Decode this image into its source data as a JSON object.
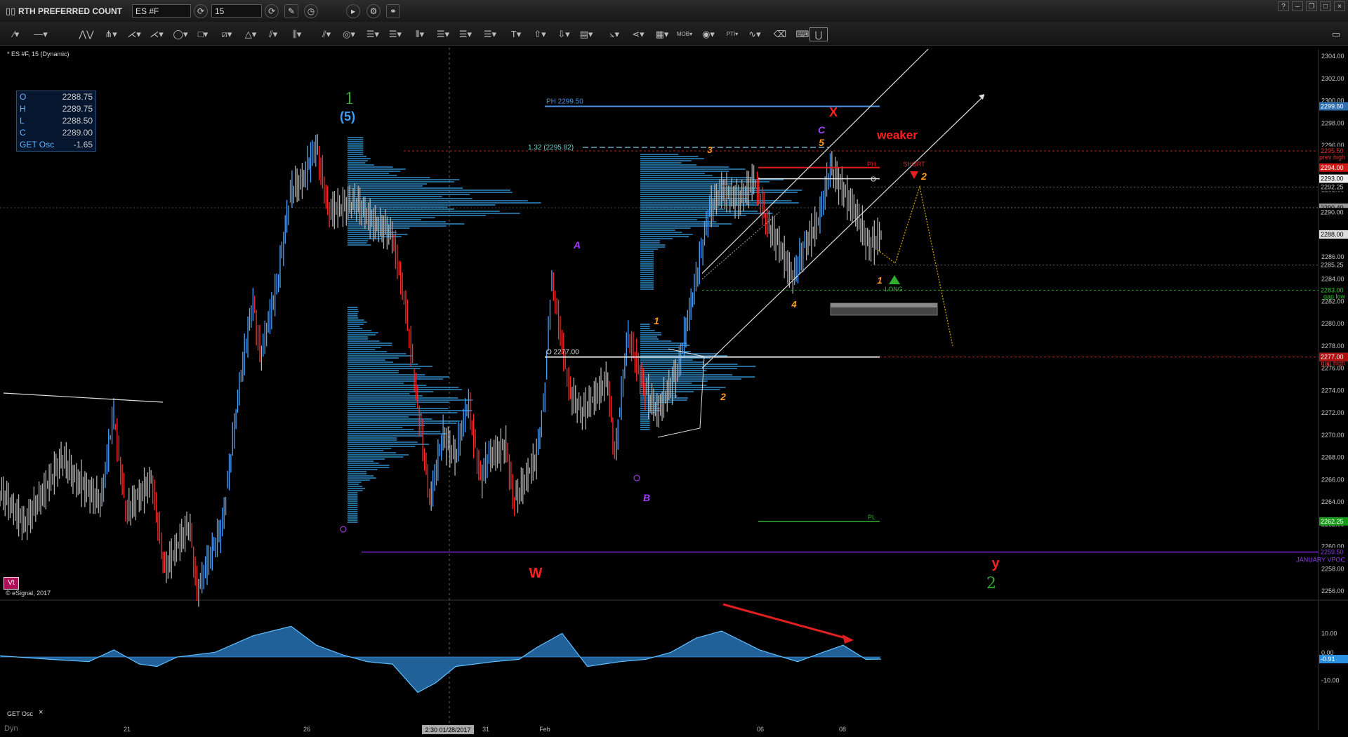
{
  "window": {
    "title": "RTH  PREFERRED COUNT",
    "symbol": "ES #F",
    "interval": "15",
    "chart_caption": "* ES #F, 15 (Dynamic)",
    "copyright": "© eSignal, 2017",
    "vt_badge": "Vt",
    "osc_caption": "GET Osc",
    "osc_close": "×",
    "dyn_label": "Dyn"
  },
  "ohlc": [
    {
      "k": "O",
      "v": "2288.75"
    },
    {
      "k": "H",
      "v": "2289.75"
    },
    {
      "k": "L",
      "v": "2288.50"
    },
    {
      "k": "C",
      "v": "2289.00"
    },
    {
      "k": "GET Osc",
      "v": "-1.65"
    }
  ],
  "colors": {
    "up_bar": "#4aa3ff",
    "down_bar": "#ff2a2a",
    "neutral_bar": "#b0b0b0",
    "profile": "#2f8dc8",
    "osc": "#3aa0ff",
    "price_axis_text": "#c8c8c8",
    "wave_orange": "#ff9a1f",
    "wave_purple": "#a040ff",
    "wave_red": "#ff2020",
    "wave_green": "#2fae2f",
    "wave_blue": "#3aa0ff",
    "vpoc": "#7a2ad6"
  },
  "chart_data": {
    "type": "candlestick",
    "x_ticks": [
      "21",
      "26",
      "31",
      "Feb",
      "06",
      "08"
    ],
    "crosshair_time": "2:30 01/28/2017",
    "y_ticks": [
      "2304.00",
      "2302.00",
      "2300.00",
      "2298.00",
      "2296.00",
      "2294.00",
      "2292.00",
      "2290.00",
      "2288.00",
      "2286.00",
      "2284.00",
      "2282.00",
      "2280.00",
      "2278.00",
      "2276.00",
      "2274.00",
      "2272.00",
      "2270.00",
      "2268.00",
      "2266.00",
      "2264.00",
      "2262.00",
      "2260.00",
      "2258.00",
      "2256.00"
    ],
    "y_range": [
      2255,
      2305
    ],
    "price_series": [
      {
        "x": 0,
        "y": 2265
      },
      {
        "x": 10,
        "y": 2262
      },
      {
        "x": 25,
        "y": 2268
      },
      {
        "x": 30,
        "y": 2266
      },
      {
        "x": 40,
        "y": 2264
      },
      {
        "x": 45,
        "y": 2272
      },
      {
        "x": 50,
        "y": 2263
      },
      {
        "x": 60,
        "y": 2266
      },
      {
        "x": 65,
        "y": 2258
      },
      {
        "x": 75,
        "y": 2262
      },
      {
        "x": 78,
        "y": 2256
      },
      {
        "x": 88,
        "y": 2262
      },
      {
        "x": 95,
        "y": 2275
      },
      {
        "x": 100,
        "y": 2282
      },
      {
        "x": 103,
        "y": 2277
      },
      {
        "x": 110,
        "y": 2284
      },
      {
        "x": 115,
        "y": 2292
      },
      {
        "x": 120,
        "y": 2293
      },
      {
        "x": 125,
        "y": 2296
      },
      {
        "x": 130,
        "y": 2290
      },
      {
        "x": 140,
        "y": 2291
      },
      {
        "x": 148,
        "y": 2289
      },
      {
        "x": 155,
        "y": 2288
      },
      {
        "x": 160,
        "y": 2282
      },
      {
        "x": 170,
        "y": 2264
      },
      {
        "x": 175,
        "y": 2270
      },
      {
        "x": 180,
        "y": 2268
      },
      {
        "x": 185,
        "y": 2273
      },
      {
        "x": 190,
        "y": 2266
      },
      {
        "x": 193,
        "y": 2268
      },
      {
        "x": 200,
        "y": 2269
      },
      {
        "x": 203,
        "y": 2264
      },
      {
        "x": 212,
        "y": 2268
      },
      {
        "x": 215,
        "y": 2273
      },
      {
        "x": 218,
        "y": 2284
      },
      {
        "x": 225,
        "y": 2274
      },
      {
        "x": 230,
        "y": 2272
      },
      {
        "x": 240,
        "y": 2275
      },
      {
        "x": 243,
        "y": 2268
      },
      {
        "x": 248,
        "y": 2279
      },
      {
        "x": 255,
        "y": 2274
      },
      {
        "x": 260,
        "y": 2272
      },
      {
        "x": 268,
        "y": 2276
      },
      {
        "x": 275,
        "y": 2284
      },
      {
        "x": 280,
        "y": 2290
      },
      {
        "x": 285,
        "y": 2292
      },
      {
        "x": 292,
        "y": 2291
      },
      {
        "x": 298,
        "y": 2293
      },
      {
        "x": 303,
        "y": 2289
      },
      {
        "x": 308,
        "y": 2287
      },
      {
        "x": 313,
        "y": 2284
      },
      {
        "x": 318,
        "y": 2287
      },
      {
        "x": 323,
        "y": 2289
      },
      {
        "x": 328,
        "y": 2294
      },
      {
        "x": 333,
        "y": 2292
      },
      {
        "x": 338,
        "y": 2290
      },
      {
        "x": 343,
        "y": 2287
      },
      {
        "x": 348,
        "y": 2288
      }
    ],
    "levels": [
      {
        "label": "PH 2299.50",
        "price": 2299.5
      },
      {
        "label": "1.32 (2295.82)",
        "price": 2295.82
      },
      {
        "label": "O 2277.00",
        "price": 2277.0
      },
      {
        "label": "PH",
        "price": 2294.0
      },
      {
        "label": "O",
        "price": 2293.0
      },
      {
        "label": "PL",
        "price": 2262.25
      }
    ],
    "price_tags": [
      {
        "text": "2299.50",
        "price": 2299.5,
        "bg": "#2f6fb0",
        "fg": "#fff"
      },
      {
        "text": "2295.50",
        "price": 2295.5,
        "bg": "#000",
        "fg": "#e03030"
      },
      {
        "text": "2294.00",
        "price": 2294.0,
        "bg": "#d01818",
        "fg": "#fff"
      },
      {
        "text": "2293.00",
        "price": 2293.0,
        "bg": "#eee",
        "fg": "#000"
      },
      {
        "text": "2292.25",
        "price": 2292.25,
        "bg": "#000",
        "fg": "#ccc"
      },
      {
        "text": "2290.40",
        "price": 2290.4,
        "bg": "#999",
        "fg": "#000"
      },
      {
        "text": "2290.00",
        "price": 2290.0,
        "bg": "#000",
        "fg": "#ccc"
      },
      {
        "text": "2288.00",
        "price": 2288.0,
        "bg": "#ddd",
        "fg": "#000"
      },
      {
        "text": "2285.25",
        "price": 2285.25,
        "bg": "#000",
        "fg": "#ccc"
      },
      {
        "text": "2283.00",
        "price": 2283.0,
        "bg": "#000",
        "fg": "#34c634"
      },
      {
        "text": "2277.00",
        "price": 2277.0,
        "bg": "#ddd",
        "fg": "#000"
      },
      {
        "text": "2277.00",
        "price": 2277.0,
        "bg": "#b01010",
        "fg": "#fff"
      },
      {
        "text": "2262.25",
        "price": 2262.25,
        "bg": "#1a9a1a",
        "fg": "#fff"
      },
      {
        "text": "2259.50",
        "price": 2259.5,
        "bg": "#000",
        "fg": "#8a40e0"
      }
    ],
    "level_notes": [
      {
        "text": "prev high",
        "color": "#e03030"
      },
      {
        "text": "gap low",
        "color": "#34c634"
      },
      {
        "text": "gap high",
        "color": "#e03030"
      },
      {
        "text": "JANUARY VPOC",
        "color": "#8a40e0"
      }
    ],
    "annotations": [
      {
        "text": "1",
        "color": "#2fae2f",
        "size": 22,
        "style": "serif"
      },
      {
        "text": "(5)",
        "color": "#3aa0ff",
        "size": 18,
        "style": "bold"
      },
      {
        "text": "X",
        "color": "#ff2020",
        "size": 18,
        "style": "bold"
      },
      {
        "text": "weaker",
        "color": "#ff2020",
        "size": 17,
        "style": "bold"
      },
      {
        "text": "C",
        "color": "#a040ff",
        "size": 14,
        "style": "italic"
      },
      {
        "text": "5",
        "color": "#ff9a1f",
        "size": 14,
        "style": "italic"
      },
      {
        "text": "3",
        "color": "#ff9a1f",
        "size": 13,
        "style": "italic"
      },
      {
        "text": "SHORT",
        "color": "#e03030",
        "size": 9,
        "style": "normal"
      },
      {
        "text": "2",
        "color": "#ff9a1f",
        "size": 14,
        "style": "italic"
      },
      {
        "text": "A",
        "color": "#a040ff",
        "size": 14,
        "style": "italic"
      },
      {
        "text": "1",
        "color": "#ff9a1f",
        "size": 13,
        "style": "italic"
      },
      {
        "text": "4",
        "color": "#ff9a1f",
        "size": 13,
        "style": "italic"
      },
      {
        "text": "LONG",
        "color": "#2fae2f",
        "size": 9,
        "style": "normal"
      },
      {
        "text": "1",
        "color": "#ff9a1f",
        "size": 14,
        "style": "italic"
      },
      {
        "text": "2",
        "color": "#ff9a1f",
        "size": 14,
        "style": "italic"
      },
      {
        "text": "B",
        "color": "#a040ff",
        "size": 14,
        "style": "italic"
      },
      {
        "text": "W",
        "color": "#ff2020",
        "size": 20,
        "style": "bold"
      },
      {
        "text": "y",
        "color": "#ff2020",
        "size": 20,
        "style": "bold"
      },
      {
        "text": "2",
        "color": "#2fae2f",
        "size": 22,
        "style": "serif"
      }
    ],
    "osc_ticks": [
      "10.00",
      "0.00",
      "-10.00"
    ],
    "osc_last": "-0.91",
    "oscillator": [
      {
        "x": 0,
        "y": 0.5
      },
      {
        "x": 20,
        "y": -1
      },
      {
        "x": 35,
        "y": -2
      },
      {
        "x": 45,
        "y": 3
      },
      {
        "x": 55,
        "y": -3
      },
      {
        "x": 62,
        "y": -4
      },
      {
        "x": 70,
        "y": 0
      },
      {
        "x": 85,
        "y": 2
      },
      {
        "x": 100,
        "y": 9
      },
      {
        "x": 115,
        "y": 13
      },
      {
        "x": 125,
        "y": 5
      },
      {
        "x": 135,
        "y": 1
      },
      {
        "x": 145,
        "y": -2
      },
      {
        "x": 155,
        "y": -3
      },
      {
        "x": 165,
        "y": -15
      },
      {
        "x": 172,
        "y": -11
      },
      {
        "x": 180,
        "y": -4
      },
      {
        "x": 195,
        "y": -2
      },
      {
        "x": 205,
        "y": -1
      },
      {
        "x": 212,
        "y": 4
      },
      {
        "x": 222,
        "y": 10
      },
      {
        "x": 232,
        "y": -4
      },
      {
        "x": 245,
        "y": -2
      },
      {
        "x": 255,
        "y": -1
      },
      {
        "x": 265,
        "y": 2
      },
      {
        "x": 275,
        "y": 8
      },
      {
        "x": 285,
        "y": 11
      },
      {
        "x": 300,
        "y": 3
      },
      {
        "x": 315,
        "y": -2
      },
      {
        "x": 325,
        "y": 2
      },
      {
        "x": 333,
        "y": 5
      },
      {
        "x": 342,
        "y": -1
      },
      {
        "x": 348,
        "y": -0.9
      }
    ]
  }
}
